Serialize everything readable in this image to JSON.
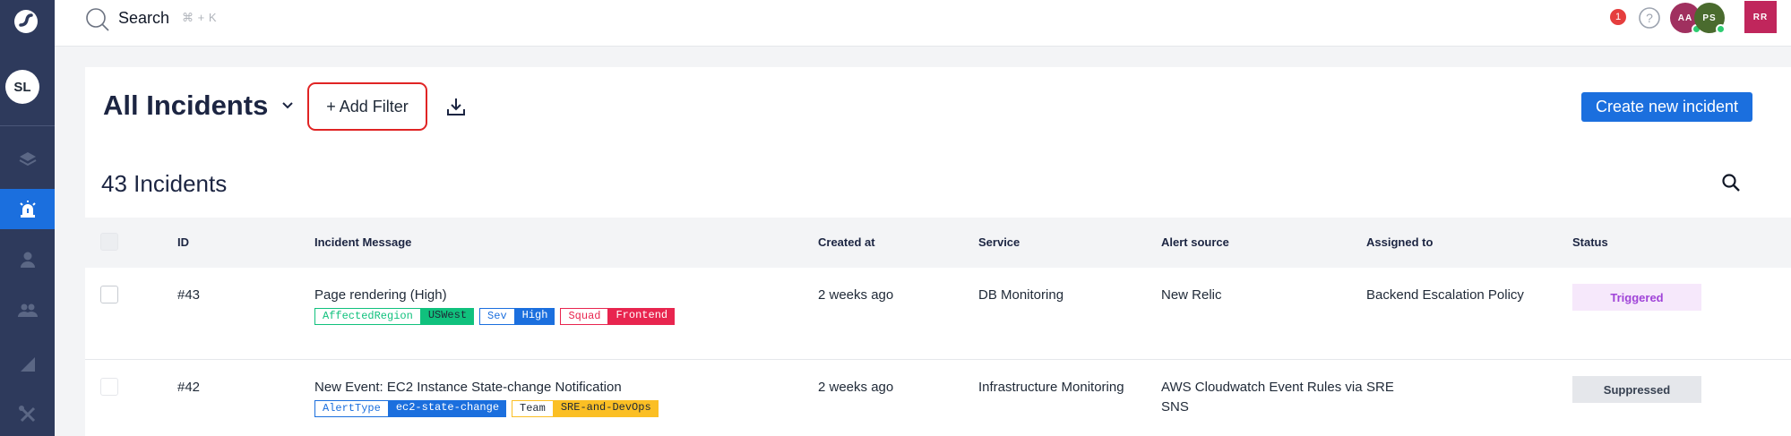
{
  "sidebar": {
    "logo_icon": "brand-logo-icon",
    "avatar_initials": "SL",
    "items": [
      {
        "name": "layers-icon",
        "active": false
      },
      {
        "name": "alarm-icon",
        "active": true
      },
      {
        "name": "user-icon",
        "active": false
      },
      {
        "name": "team-icon",
        "active": false
      },
      {
        "name": "chart-icon",
        "active": false
      },
      {
        "name": "tools-icon",
        "active": false
      }
    ]
  },
  "topbar": {
    "search_label": "Search",
    "search_hint": "⌘ + K",
    "notification_count": "1",
    "users": [
      {
        "initials": "AA",
        "color": "#a0305f"
      },
      {
        "initials": "PS",
        "color": "#4a6b2e"
      }
    ],
    "current_user_initials": "RR"
  },
  "header": {
    "title": "All Incidents",
    "add_filter_label": "+ Add Filter",
    "create_label": "Create new incident",
    "count_label": "43 Incidents"
  },
  "table": {
    "columns": [
      "ID",
      "Incident Message",
      "Created at",
      "Service",
      "Alert source",
      "Assigned to",
      "Status"
    ],
    "rows": [
      {
        "id": "#43",
        "message": "Page rendering (High)",
        "created": "2 weeks ago",
        "service": "DB Monitoring",
        "source": "New Relic",
        "assigned": "Backend Escalation Policy",
        "status": "Triggered",
        "tags": [
          {
            "key": "AffectedRegion",
            "value": "USWest",
            "color": "#10c17d"
          },
          {
            "key": "Sev",
            "value": "High",
            "color": "#1b6fde"
          },
          {
            "key": "Squad",
            "value": "Frontend",
            "color": "#e8254f"
          }
        ]
      },
      {
        "id": "#42",
        "message": "New Event: EC2 Instance State-change Notification",
        "created": "2 weeks ago",
        "service": "Infrastructure Monitoring",
        "source": "AWS Cloudwatch Event Rules via SNS",
        "assigned": "SRE",
        "status": "Suppressed",
        "tags": [
          {
            "key": "AlertType",
            "value": "ec2-state-change",
            "color": "#1b6fde"
          },
          {
            "key": "Team",
            "value": "SRE-and-DevOps",
            "color": "#fbbf24"
          }
        ]
      }
    ]
  },
  "colors": {
    "accent": "#1b6fde",
    "sidebar": "#2e3a5c",
    "triggered_bg": "#f6e8fb",
    "triggered_text": "#a044d8",
    "suppressed_bg": "#e5e7eb",
    "suppressed_text": "#374151"
  }
}
